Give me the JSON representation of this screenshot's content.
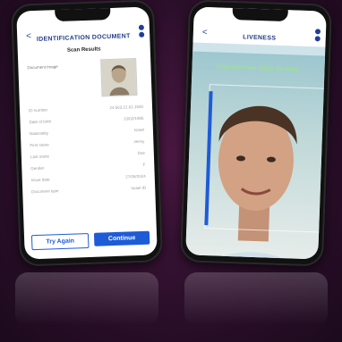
{
  "left_phone": {
    "back_glyph": "<",
    "title": "IDENTIFICATION DOCUMENT",
    "subtitle": "Scan Results",
    "doc_image_label": "Document Image",
    "fields": [
      {
        "label": "ID number",
        "value": "24.563.21.01.1500"
      },
      {
        "label": "Date of birth",
        "value": "13/02/1985"
      },
      {
        "label": "Nationality",
        "value": "Israel"
      },
      {
        "label": "First name",
        "value": "Jenny"
      },
      {
        "label": "Last name",
        "value": "Doe"
      },
      {
        "label": "Gender",
        "value": "F"
      },
      {
        "label": "Issue date",
        "value": "27/09/2024"
      },
      {
        "label": "Document type",
        "value": "Israel ID"
      }
    ],
    "try_again_label": "Try Again",
    "continue_label": "Continue"
  },
  "right_phone": {
    "back_glyph": "<",
    "title": "LIVENESS",
    "instruction": "Place your face within the frame"
  },
  "colors": {
    "accent": "#1e5bd6",
    "title": "#233c85",
    "instruction": "#9de38e"
  }
}
